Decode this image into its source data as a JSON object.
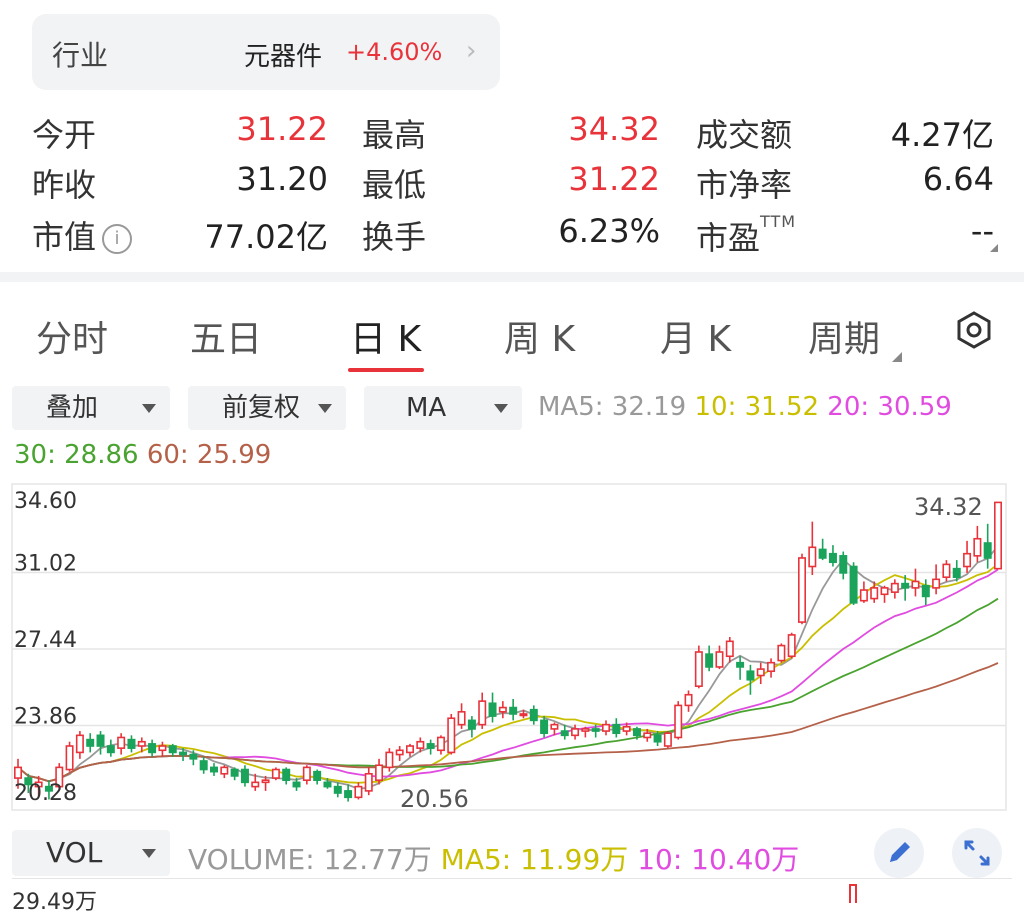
{
  "industry": {
    "label": "行业",
    "name": "元器件",
    "change": "+4.60%"
  },
  "quote": {
    "open_label": "今开",
    "open": "31.22",
    "high_label": "最高",
    "high": "34.32",
    "amount_label": "成交额",
    "amount": "4.27亿",
    "prev_close_label": "昨收",
    "prev_close": "31.20",
    "low_label": "最低",
    "low": "31.22",
    "pb_label": "市净率",
    "pb": "6.64",
    "mcap_label": "市值",
    "mcap": "77.02亿",
    "turnover_label": "换手",
    "turnover": "6.23%",
    "pe_label": "市盈",
    "pe_sup": "TTM",
    "pe": "--"
  },
  "tabs": [
    "分时",
    "五日",
    "日 K",
    "周 K",
    "月 K",
    "周期"
  ],
  "active_tab": "日 K",
  "selectors": {
    "overlay": "叠加",
    "adjust": "前复权",
    "indicator": "MA"
  },
  "ma_legend": {
    "ma5": "MA5: 32.19",
    "ma10": "10: 31.52",
    "ma20": "20: 30.59",
    "ma30": "30: 28.86",
    "ma60": "60: 25.99"
  },
  "colors": {
    "up": "#e8333b",
    "down": "#1aa35a",
    "ma5": "#999999",
    "ma10": "#c9bf00",
    "ma20": "#e04ce0",
    "ma30": "#4aa330",
    "ma60": "#b5614a"
  },
  "volume": {
    "selector": "VOL",
    "volume": "VOLUME: 12.77万",
    "ma5": "MA5: 11.99万",
    "ma10": "10: 10.40万",
    "axis_top": "29.49万"
  },
  "chart_data": {
    "type": "candlestick",
    "y_ticks": [
      "34.60",
      "31.02",
      "27.44",
      "23.86",
      "20.28"
    ],
    "ylim": [
      20.28,
      34.6
    ],
    "annotations": {
      "max": "34.32",
      "min": "20.56"
    },
    "candles": [
      [
        21.4,
        21.9,
        20.9,
        22.3
      ],
      [
        21.4,
        21.1,
        20.7,
        21.6
      ],
      [
        21.0,
        21.2,
        20.5,
        21.5
      ],
      [
        21.0,
        20.8,
        20.4,
        21.3
      ],
      [
        21.0,
        21.9,
        20.9,
        22.1
      ],
      [
        21.8,
        22.9,
        21.7,
        23.1
      ],
      [
        22.6,
        23.4,
        22.3,
        23.6
      ],
      [
        23.2,
        22.9,
        22.6,
        23.5
      ],
      [
        23.4,
        22.9,
        22.5,
        23.6
      ],
      [
        22.9,
        22.6,
        22.4,
        23.2
      ],
      [
        22.8,
        23.3,
        22.5,
        23.5
      ],
      [
        23.2,
        22.8,
        22.6,
        23.4
      ],
      [
        22.9,
        23.1,
        22.6,
        23.3
      ],
      [
        23.0,
        22.6,
        22.4,
        23.2
      ],
      [
        22.7,
        22.9,
        22.4,
        23.1
      ],
      [
        22.9,
        22.6,
        22.4,
        23.0
      ],
      [
        22.6,
        22.5,
        22.2,
        22.8
      ],
      [
        22.5,
        22.3,
        22.0,
        22.7
      ],
      [
        22.2,
        21.8,
        21.6,
        22.4
      ],
      [
        21.9,
        21.7,
        21.5,
        22.1
      ],
      [
        21.6,
        21.9,
        21.4,
        22.0
      ],
      [
        21.8,
        21.5,
        21.3,
        21.9
      ],
      [
        21.8,
        21.2,
        21.0,
        22.0
      ],
      [
        21.0,
        21.2,
        20.8,
        21.6
      ],
      [
        21.2,
        21.3,
        20.8,
        21.5
      ],
      [
        21.4,
        21.8,
        21.3,
        21.9
      ],
      [
        21.8,
        21.3,
        21.1,
        21.9
      ],
      [
        21.2,
        21.0,
        20.8,
        21.4
      ],
      [
        21.3,
        21.9,
        21.1,
        22.0
      ],
      [
        21.7,
        21.3,
        21.1,
        21.8
      ],
      [
        21.2,
        21.0,
        20.9,
        21.4
      ],
      [
        21.0,
        20.7,
        20.5,
        21.2
      ],
      [
        20.8,
        20.5,
        20.3,
        21.1
      ],
      [
        20.5,
        21.0,
        20.4,
        21.2
      ],
      [
        20.8,
        21.6,
        20.6,
        21.9
      ],
      [
        21.3,
        22.0,
        21.1,
        22.3
      ],
      [
        21.9,
        22.6,
        21.7,
        22.8
      ],
      [
        22.5,
        22.7,
        22.2,
        22.9
      ],
      [
        22.6,
        22.9,
        22.4,
        23.0
      ],
      [
        22.8,
        23.1,
        22.6,
        23.3
      ],
      [
        23.0,
        22.8,
        22.5,
        23.2
      ],
      [
        22.7,
        23.3,
        22.5,
        23.4
      ],
      [
        22.6,
        24.2,
        22.5,
        24.4
      ],
      [
        23.9,
        24.5,
        23.7,
        24.9
      ],
      [
        24.1,
        23.7,
        23.3,
        24.3
      ],
      [
        23.9,
        25.0,
        23.7,
        25.4
      ],
      [
        24.9,
        24.3,
        24.0,
        25.4
      ],
      [
        24.5,
        24.7,
        24.2,
        25.0
      ],
      [
        24.7,
        24.4,
        24.1,
        25.1
      ],
      [
        24.4,
        24.4,
        24.2,
        24.6
      ],
      [
        24.6,
        24.1,
        23.9,
        24.8
      ],
      [
        24.1,
        23.5,
        23.3,
        24.3
      ],
      [
        23.7,
        23.9,
        23.4,
        24.0
      ],
      [
        23.6,
        23.4,
        23.2,
        23.9
      ],
      [
        23.4,
        23.7,
        23.2,
        23.9
      ],
      [
        23.6,
        23.7,
        23.3,
        23.8
      ],
      [
        23.7,
        23.6,
        23.3,
        23.9
      ],
      [
        23.6,
        23.9,
        23.4,
        24.1
      ],
      [
        23.9,
        23.5,
        23.3,
        24.2
      ],
      [
        23.6,
        23.8,
        23.4,
        24.0
      ],
      [
        23.7,
        23.4,
        23.2,
        23.8
      ],
      [
        23.3,
        23.5,
        23.1,
        23.7
      ],
      [
        23.4,
        23.1,
        22.9,
        23.6
      ],
      [
        22.9,
        23.5,
        22.8,
        23.6
      ],
      [
        23.3,
        24.8,
        23.2,
        25.0
      ],
      [
        24.8,
        25.3,
        24.5,
        25.5
      ],
      [
        25.7,
        27.3,
        25.6,
        27.6
      ],
      [
        27.2,
        26.6,
        26.4,
        27.6
      ],
      [
        26.6,
        27.3,
        26.5,
        27.6
      ],
      [
        27.1,
        27.8,
        26.8,
        28.0
      ],
      [
        26.8,
        26.6,
        26.0,
        27.1
      ],
      [
        26.4,
        26.0,
        25.3,
        26.7
      ],
      [
        26.2,
        26.5,
        25.8,
        26.8
      ],
      [
        26.4,
        26.8,
        26.1,
        27.0
      ],
      [
        26.9,
        27.6,
        26.8,
        27.7
      ],
      [
        27.1,
        28.1,
        27.0,
        28.2
      ],
      [
        28.7,
        31.7,
        28.6,
        31.9
      ],
      [
        31.3,
        32.2,
        30.9,
        33.4
      ],
      [
        32.1,
        31.7,
        31.6,
        32.6
      ],
      [
        31.9,
        31.5,
        31.3,
        32.3
      ],
      [
        31.8,
        31.0,
        30.7,
        32.0
      ],
      [
        31.3,
        29.6,
        29.5,
        31.5
      ],
      [
        29.7,
        30.2,
        29.6,
        30.6
      ],
      [
        29.8,
        30.3,
        29.6,
        30.6
      ],
      [
        30.0,
        30.3,
        29.6,
        30.4
      ],
      [
        30.1,
        30.5,
        29.8,
        30.7
      ],
      [
        30.5,
        30.3,
        29.7,
        30.9
      ],
      [
        30.3,
        30.6,
        29.9,
        31.2
      ],
      [
        30.4,
        29.9,
        29.5,
        30.7
      ],
      [
        30.3,
        30.7,
        30.0,
        31.4
      ],
      [
        30.8,
        31.4,
        30.6,
        31.6
      ],
      [
        31.2,
        30.8,
        30.6,
        31.6
      ],
      [
        31.3,
        31.9,
        31.0,
        32.5
      ],
      [
        31.8,
        32.6,
        31.5,
        33.2
      ],
      [
        32.4,
        31.7,
        31.2,
        33.3
      ],
      [
        31.2,
        34.3,
        31.2,
        34.3
      ]
    ]
  }
}
